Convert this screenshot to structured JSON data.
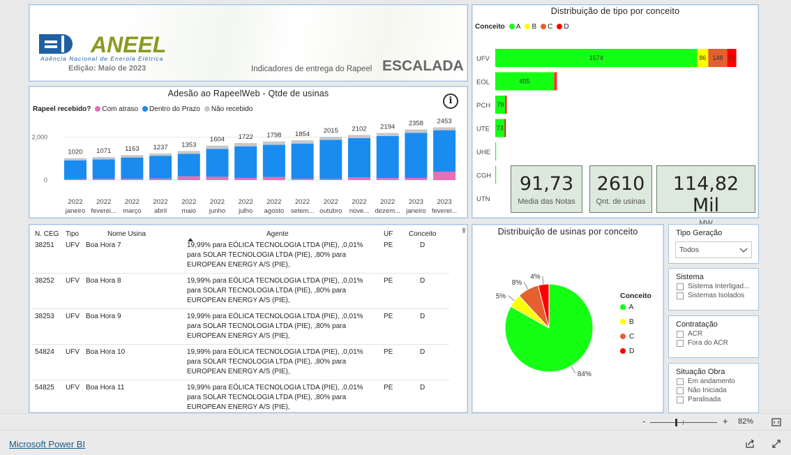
{
  "header": {
    "logo_text": "ANEEL",
    "logo_subtitle": "Agência Nacional de Energia Elétrica",
    "edition": "Edição: Maio de 2023",
    "indicator_label": "Indicadores de entrega do Rapeel",
    "escalada": "ESCALADA"
  },
  "adhesion": {
    "title": "Adesão ao RapeelWeb - Qtde de usinas",
    "legend_title": "Rapeel recebido?",
    "legend": [
      {
        "label": "Com atraso",
        "color": "#e66fb6"
      },
      {
        "label": "Dentro do Prazo",
        "color": "#1a8cf0"
      },
      {
        "label": "Não recebido",
        "color": "#c8c8c8"
      }
    ],
    "y_ticks": [
      "2,000",
      "0"
    ],
    "info_icon": "info-icon"
  },
  "chart_data": [
    {
      "type": "bar",
      "stacked": true,
      "title": "Adesão ao RapeelWeb - Qtde de usinas",
      "categories": [
        [
          "2022",
          "janeiro"
        ],
        [
          "2022",
          "feverei..."
        ],
        [
          "2022",
          "março"
        ],
        [
          "2022",
          "abril"
        ],
        [
          "2022",
          "maio"
        ],
        [
          "2022",
          "junho"
        ],
        [
          "2022",
          "julho"
        ],
        [
          "2022",
          "agosto"
        ],
        [
          "2022",
          "setem..."
        ],
        [
          "2022",
          "outubro"
        ],
        [
          "2022",
          "nove..."
        ],
        [
          "2022",
          "dezem..."
        ],
        [
          "2023",
          "janeiro"
        ],
        [
          "2023",
          "feverei..."
        ]
      ],
      "totals": [
        1020,
        1071,
        1163,
        1237,
        1353,
        1604,
        1722,
        1798,
        1854,
        2015,
        2102,
        2194,
        2358,
        2453
      ],
      "series": [
        {
          "name": "Com atraso",
          "values": [
            40,
            60,
            60,
            70,
            170,
            150,
            100,
            140,
            60,
            50,
            120,
            90,
            100,
            390
          ]
        },
        {
          "name": "Dentro do Prazo",
          "values": [
            880,
            900,
            990,
            1060,
            1050,
            1300,
            1470,
            1500,
            1640,
            1820,
            1830,
            1960,
            2100,
            1930
          ]
        },
        {
          "name": "Não recebido",
          "values": [
            100,
            111,
            113,
            107,
            133,
            154,
            152,
            158,
            154,
            145,
            152,
            144,
            158,
            133
          ]
        }
      ],
      "ylim": [
        0,
        2600
      ]
    },
    {
      "type": "bar",
      "orientation": "horizontal",
      "stacked": true,
      "title": "Distribuição de tipo por conceito",
      "categories": [
        "UFV",
        "EOL",
        "PCH",
        "UTE",
        "UHE",
        "CGH",
        "UTN"
      ],
      "series": [
        {
          "name": "A",
          "values": [
            1574,
            455,
            79,
            73,
            2,
            1,
            0
          ]
        },
        {
          "name": "B",
          "values": [
            86,
            0,
            0,
            0,
            0,
            0,
            0
          ]
        },
        {
          "name": "C",
          "values": [
            148,
            14,
            0,
            0,
            0,
            0,
            0
          ]
        },
        {
          "name": "D",
          "values": [
            71,
            10,
            10,
            10,
            0,
            0,
            0
          ]
        }
      ]
    },
    {
      "type": "pie",
      "title": "Distribuição de usinas por conceito",
      "labels": [
        "A",
        "B",
        "C",
        "D"
      ],
      "values": [
        84,
        5,
        8,
        4
      ]
    }
  ],
  "types": {
    "title": "Distribuição de tipo por conceito",
    "legend_title": "Conceito",
    "legend": [
      {
        "label": "A",
        "color": "#15ff15"
      },
      {
        "label": "B",
        "color": "#ffff00"
      },
      {
        "label": "C",
        "color": "#e4602e"
      },
      {
        "label": "D",
        "color": "#ff0000"
      }
    ]
  },
  "cards": [
    {
      "value": "91,73",
      "label": "Media das Notas"
    },
    {
      "value": "2610",
      "label": "Qnt. de usinas"
    },
    {
      "value": "114,82 Mil",
      "label": "MW"
    }
  ],
  "table": {
    "columns": [
      "N. CEG",
      "Tipo",
      "Nome Usina",
      "Agente",
      "UF",
      "Conceito"
    ],
    "agent_text": "19,99% para EÓLICA TECNOLOGIA LTDA (PIE), ,0,01% para SOLAR TECNOLOGIA LTDA (PIE), ,80% para EUROPEAN ENERGY A/S (PIE),",
    "rows": [
      {
        "ceg": "38251",
        "tipo": "UFV",
        "nome": "Boa Hora 7",
        "uf": "PE",
        "conceito": "D"
      },
      {
        "ceg": "38252",
        "tipo": "UFV",
        "nome": "Boa Hora 8",
        "uf": "PE",
        "conceito": "D"
      },
      {
        "ceg": "38253",
        "tipo": "UFV",
        "nome": "Boa Hora 9",
        "uf": "PE",
        "conceito": "D"
      },
      {
        "ceg": "54824",
        "tipo": "UFV",
        "nome": "Boa Hora 10",
        "uf": "PE",
        "conceito": "D"
      },
      {
        "ceg": "54825",
        "tipo": "UFV",
        "nome": "Boa Hora 11",
        "uf": "PE",
        "conceito": "D"
      }
    ]
  },
  "pie": {
    "title": "Distribuição de usinas por conceito",
    "legend_title": "Conceito",
    "labels": [
      "84%",
      "5%",
      "8%",
      "4%"
    ]
  },
  "slicers": {
    "tipo": {
      "title": "Tipo Geração",
      "selected": "Todos"
    },
    "sistema": {
      "title": "Sistema",
      "options": [
        "Sistema Interligad...",
        "Sistemas Isolados"
      ]
    },
    "contratacao": {
      "title": "Contratação",
      "options": [
        "ACR",
        "Fora do ACR"
      ]
    },
    "situacao": {
      "title": "Situação Obra",
      "options": [
        "Em andamento",
        "Não Iniciada",
        "Paralisada"
      ]
    }
  },
  "zoom": {
    "minus": "-",
    "plus": "+",
    "value": "82%"
  },
  "footer": {
    "brand": "Microsoft Power BI"
  }
}
